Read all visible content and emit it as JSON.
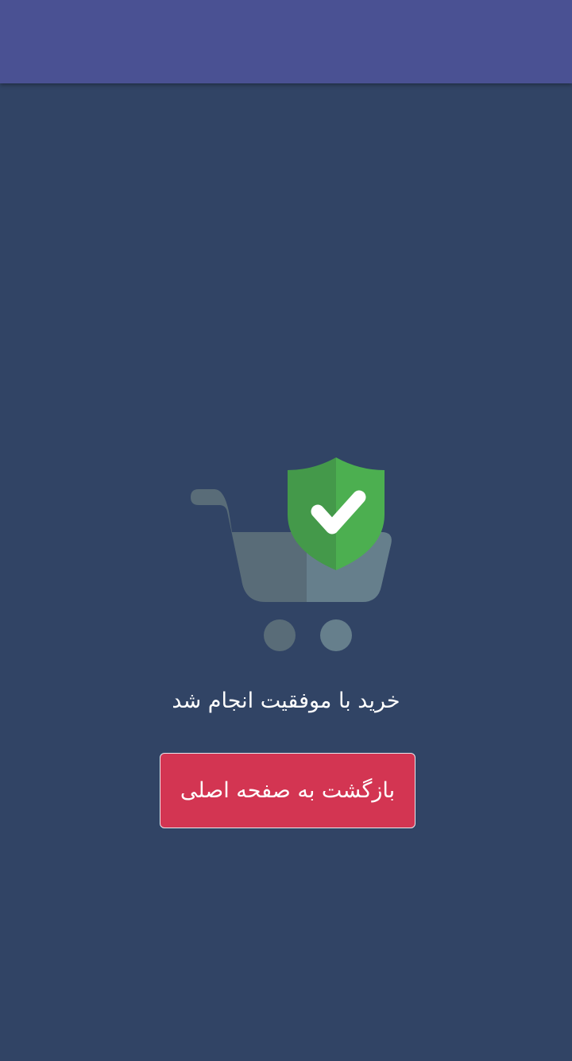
{
  "app_bar": {
    "title": ""
  },
  "illustration": {
    "icon": "cart-shield-check-icon",
    "colors": {
      "cart_left": "#596c78",
      "cart_right": "#667f8c",
      "shield_left": "#44994a",
      "shield_right": "#4caf50",
      "check": "#ffffff"
    }
  },
  "status": {
    "message": "خرید با موفقیت انجام شد"
  },
  "actions": {
    "back_home_label": "بازگشت به صفحه اصلی"
  },
  "colors": {
    "app_bar": "#4a5193",
    "background": "#314465",
    "button": "#d33552"
  }
}
